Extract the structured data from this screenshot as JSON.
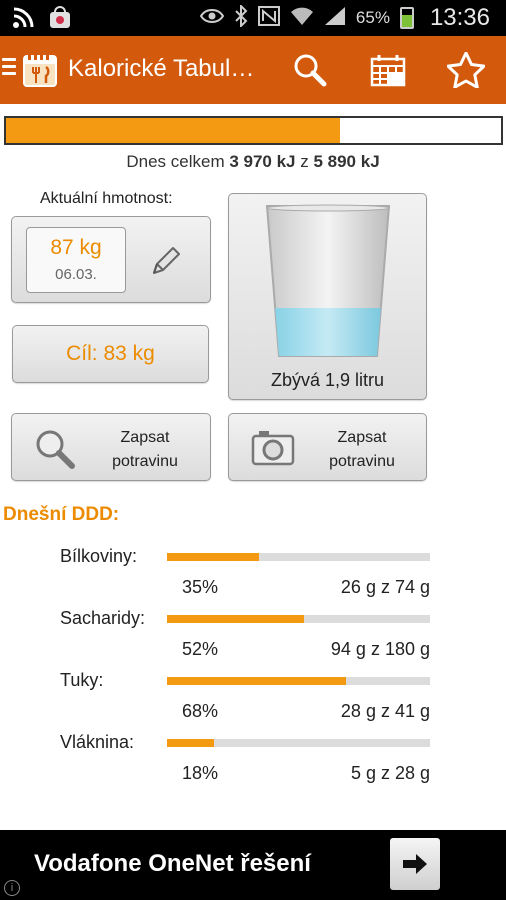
{
  "status_bar": {
    "battery": "65%",
    "time": "13:36",
    "battery_level": 0.65
  },
  "app_bar": {
    "title": "Kalorické Tabul…"
  },
  "calories": {
    "progress_fraction": 0.674,
    "prefix": "Dnes celkem ",
    "consumed": "3 970 kJ",
    "separator": " z ",
    "target": "5 890 kJ"
  },
  "weight": {
    "label": "Aktuální hmotnost:",
    "value": "87 kg",
    "date": "06.03.",
    "goal": "Cíl: 83 kg"
  },
  "water": {
    "remaining": "Zbývá 1,9 litru",
    "fill_fraction": 0.32
  },
  "log_buttons": [
    {
      "label": "Zapsat potravinu",
      "icon": "search-icon"
    },
    {
      "label": "Zapsat potravinu",
      "icon": "camera-icon"
    }
  ],
  "ddd": {
    "title": "Dnešní DDD:",
    "items": [
      {
        "name": "Bílkoviny:",
        "percent": "35%",
        "amount": "26 g z 74 g",
        "fraction": 0.35
      },
      {
        "name": "Sacharidy:",
        "percent": "52%",
        "amount": "94 g z 180 g",
        "fraction": 0.52
      },
      {
        "name": "Tuky:",
        "percent": "68%",
        "amount": "28 g z 41 g",
        "fraction": 0.68
      },
      {
        "name": "Vláknina:",
        "percent": "18%",
        "amount": "5 g z 28 g",
        "fraction": 0.18
      }
    ]
  },
  "ad": {
    "text": "Vodafone OneNet řešení",
    "info": "i"
  },
  "colors": {
    "accent": "#ec8b00",
    "app_bar": "#d35a0c",
    "progress": "#f39a12"
  }
}
